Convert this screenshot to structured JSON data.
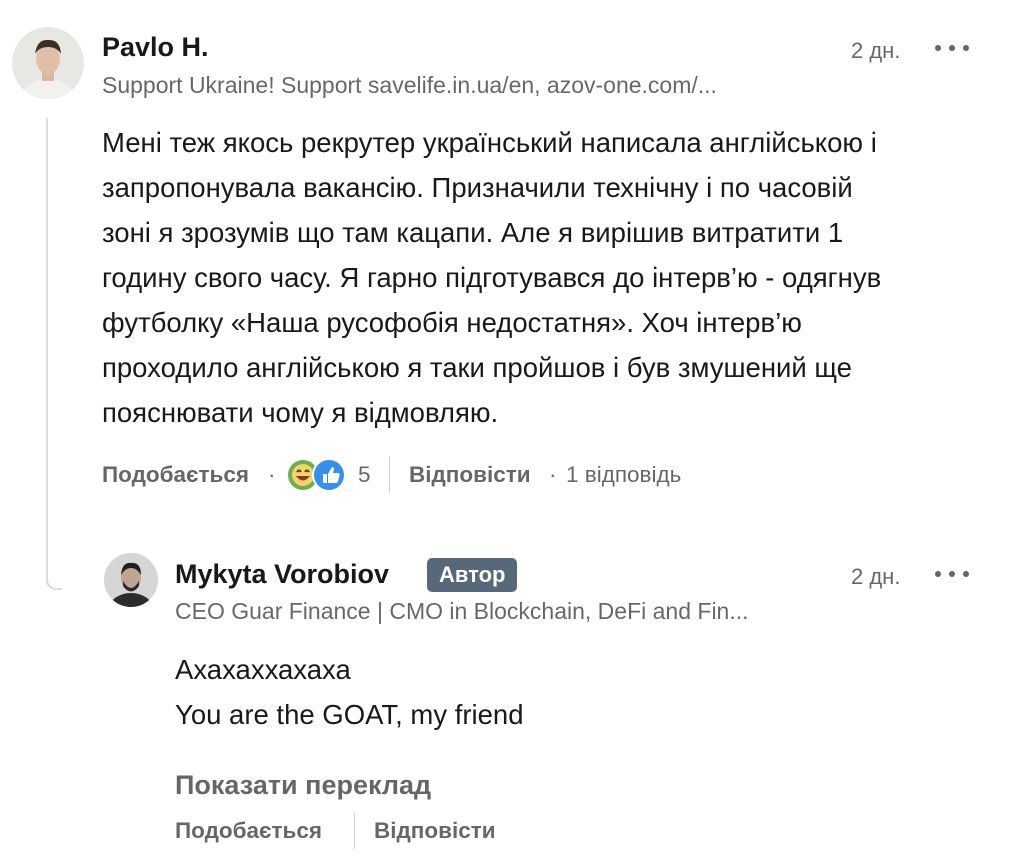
{
  "comment": {
    "author": "Pavlo H.",
    "headline": "Support Ukraine! Support savelife.in.ua/en, azov-one.com/...",
    "time": "2 дн.",
    "lines": [
      "Мені теж якось рекрутер український написала англійською і",
      "запропонувала вакансію. Призначили технічну і по часовій",
      "зоні я зрозумів що там кацапи. Але я вирішив витратити 1",
      "годину свого часу. Я гарно підготувався до інтерв’ю - одягнув",
      "футболку «Наша русофобія недостатня». Хоч інтерв’ю",
      "проходило англійською я таки пройшов і був змушений ще",
      "пояснювати чому я відмовляю."
    ],
    "like_label": "Подобається",
    "dot": "·",
    "reaction_count": "5",
    "reply_label": "Відповісти",
    "replies_count": "1 відповідь",
    "reaction_icons": [
      "laugh-reaction-icon",
      "like-reaction-icon"
    ]
  },
  "reply": {
    "author": "Mykyta Vorobiov",
    "badge": "Автор",
    "headline": "CEO Guar Finance | CMO in Blockchain, DeFi and Fin...",
    "time": "2 дн.",
    "lines": [
      "Ахахаххахаха",
      "You are the GOAT, my friend"
    ],
    "translate_label": "Показати переклад",
    "like_label": "Подобається",
    "reply_label": "Відповісти"
  },
  "colors": {
    "badge_bg": "#56687a",
    "muted_text": "rgba(0,0,0,0.6)",
    "thread_line": "#dcdcdc"
  }
}
